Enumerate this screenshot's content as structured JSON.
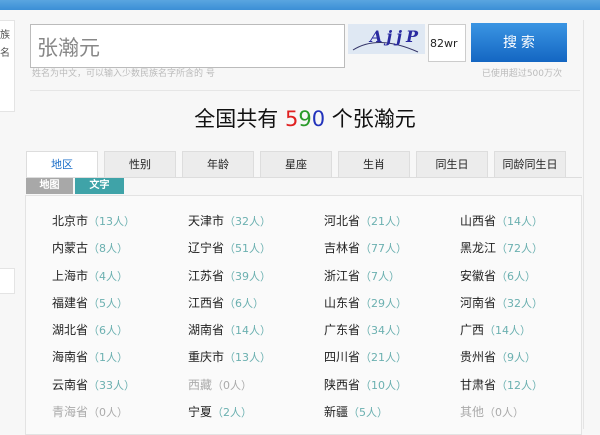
{
  "left_fragments": [
    "族",
    "名"
  ],
  "search": {
    "value": "张瀚元",
    "captcha_text": "AjjP",
    "code_value": "82wr",
    "button_label": "搜 索",
    "hint": "姓名为中文，可以输入少数民族名字所含的 号",
    "usage": "已使用超过500万次"
  },
  "headline": {
    "prefix": "全国共有 ",
    "count_digits": [
      "5",
      "9",
      "0"
    ],
    "suffix": " 个张瀚元"
  },
  "tabs": [
    {
      "label": "地区",
      "active": true
    },
    {
      "label": "性别"
    },
    {
      "label": "年龄"
    },
    {
      "label": "星座"
    },
    {
      "label": "生肖"
    },
    {
      "label": "同生日"
    },
    {
      "label": "同龄同生日"
    }
  ],
  "subtabs": [
    {
      "label": "地图",
      "color": "#a8a8a8"
    },
    {
      "label": "文字",
      "color": "#3fa3a8"
    }
  ],
  "regions": [
    {
      "name": "北京市",
      "count": "（13人）"
    },
    {
      "name": "天津市",
      "count": "（32人）"
    },
    {
      "name": "河北省",
      "count": "（21人）"
    },
    {
      "name": "山西省",
      "count": "（14人）"
    },
    {
      "name": "内蒙古",
      "count": "（8人）"
    },
    {
      "name": "辽宁省",
      "count": "（51人）"
    },
    {
      "name": "吉林省",
      "count": "（77人）"
    },
    {
      "name": "黑龙江",
      "count": "（72人）"
    },
    {
      "name": "上海市",
      "count": "（4人）"
    },
    {
      "name": "江苏省",
      "count": "（39人）"
    },
    {
      "name": "浙江省",
      "count": "（7人）"
    },
    {
      "name": "安徽省",
      "count": "（6人）"
    },
    {
      "name": "福建省",
      "count": "（5人）"
    },
    {
      "name": "江西省",
      "count": "（6人）"
    },
    {
      "name": "山东省",
      "count": "（29人）"
    },
    {
      "name": "河南省",
      "count": "（32人）"
    },
    {
      "name": "湖北省",
      "count": "（6人）"
    },
    {
      "name": "湖南省",
      "count": "（14人）"
    },
    {
      "name": "广东省",
      "count": "（34人）"
    },
    {
      "name": "广西",
      "count": "（14人）"
    },
    {
      "name": "海南省",
      "count": "（1人）"
    },
    {
      "name": "重庆市",
      "count": "（13人）"
    },
    {
      "name": "四川省",
      "count": "（21人）"
    },
    {
      "name": "贵州省",
      "count": "（9人）"
    },
    {
      "name": "云南省",
      "count": "（33人）"
    },
    {
      "name": "西藏",
      "count": "（0人）",
      "zero": true
    },
    {
      "name": "陕西省",
      "count": "（10人）"
    },
    {
      "name": "甘肃省",
      "count": "（12人）"
    },
    {
      "name": "青海省",
      "count": "（0人）",
      "zero": true
    },
    {
      "name": "宁夏",
      "count": "（2人）"
    },
    {
      "name": "新疆",
      "count": "（5人）"
    },
    {
      "name": "其他",
      "count": "（0人）",
      "zero": true
    }
  ]
}
